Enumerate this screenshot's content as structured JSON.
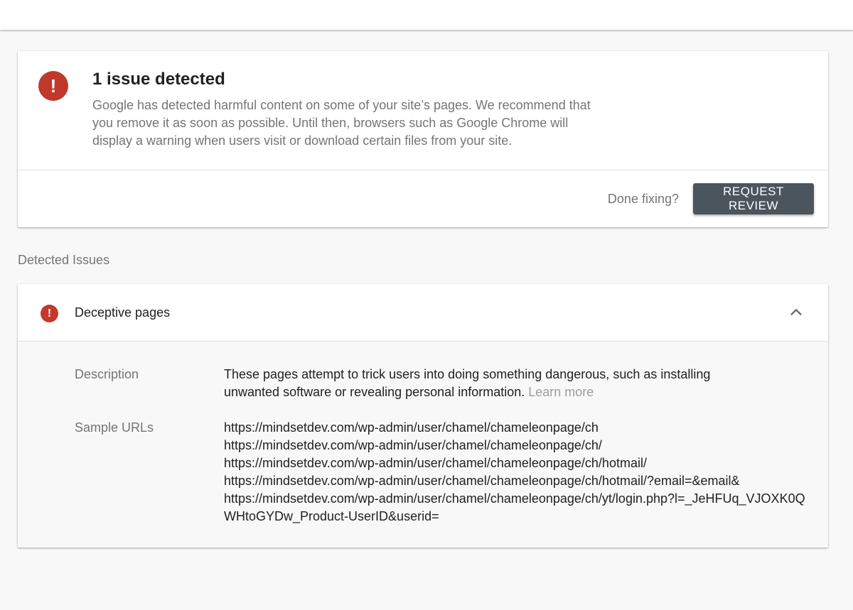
{
  "summary": {
    "title": "1 issue detected",
    "description": "Google has detected harmful content on some of your site’s pages. We recommend that you remove it as soon as possible. Until then, browsers such as Google Chrome will display a warning when users visit or download certain files from your site.",
    "done_fixing": "Done fixing?",
    "request_review": "REQUEST REVIEW",
    "icon": "alert-circle-icon"
  },
  "detected_issues_label": "Detected Issues",
  "issue": {
    "title": "Deceptive pages",
    "icon": "alert-circle-icon",
    "expanded": true,
    "description_label": "Description",
    "description_text": "These pages attempt to trick users into doing something dangerous, such as installing unwanted software or revealing personal information.",
    "learn_more": "Learn more",
    "sample_urls_label": "Sample URLs",
    "sample_urls": [
      "https://mindsetdev.com/wp-admin/user/chamel/chameleonpage/ch",
      "https://mindsetdev.com/wp-admin/user/chamel/chameleonpage/ch/",
      "https://mindsetdev.com/wp-admin/user/chamel/chameleonpage/ch/hotmail/",
      "https://mindsetdev.com/wp-admin/user/chamel/chameleonpage/ch/hotmail/?email=&email&",
      "https://mindsetdev.com/wp-admin/user/chamel/chameleonpage/ch/yt/login.php?l=_JeHFUq_VJOXK0QWHtoGYDw_Product-UserID&userid="
    ]
  },
  "colors": {
    "alert": "#c0392b",
    "button": "#4a555e",
    "muted_text": "#757575",
    "background": "#f8f8f8"
  }
}
